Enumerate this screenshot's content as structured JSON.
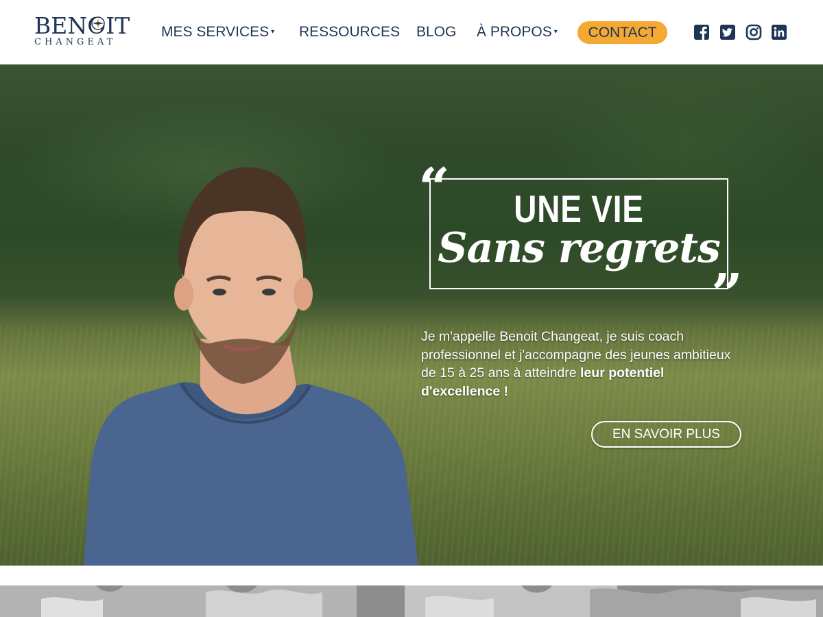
{
  "header": {
    "logo_main": "BENOIT",
    "logo_sub": "CHANGEAT",
    "nav": [
      {
        "label": "MES SERVICES",
        "has_caret": true
      },
      {
        "label": "RESSOURCES",
        "has_caret": false
      },
      {
        "label": "BLOG",
        "has_caret": false
      },
      {
        "label": "À PROPOS",
        "has_caret": true
      }
    ],
    "caret": "▾",
    "contact_label": "CONTACT",
    "social": [
      "facebook-icon",
      "twitter-icon",
      "instagram-icon",
      "linkedin-icon"
    ]
  },
  "hero": {
    "quote_open": "“",
    "quote_close": "”",
    "headline_line1": "UNE VIE",
    "headline_line2": "Sans regrets",
    "intro_text": "Je m'appelle Benoit Changeat, je suis coach professionnel et j'accompagne des jeunes ambitieux de 15 à 25 ans à atteindre ",
    "intro_bold": "leur potentiel d'excellence !",
    "cta_label": "EN SAVOIR PLUS"
  },
  "colors": {
    "navy": "#1e3556",
    "accent": "#f5a832",
    "white": "#ffffff"
  }
}
